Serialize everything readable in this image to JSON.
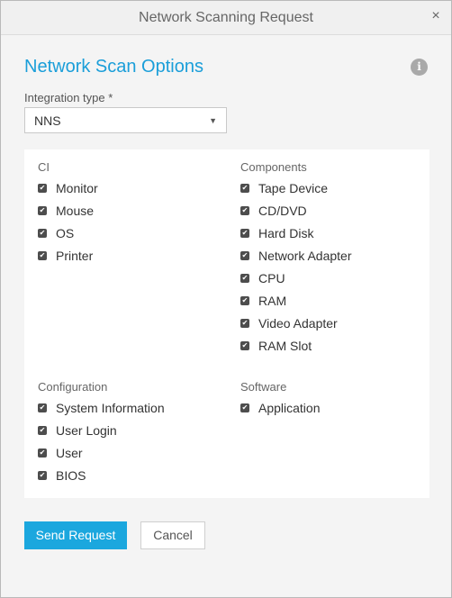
{
  "window": {
    "title": "Network Scanning Request",
    "close_glyph": "×"
  },
  "form": {
    "heading": "Network Scan Options",
    "info_icon": "i",
    "integration_label": "Integration type *",
    "integration_value": "NNS"
  },
  "groups": {
    "ci": {
      "title": "CI",
      "items": [
        "Monitor",
        "Mouse",
        "OS",
        "Printer"
      ]
    },
    "components": {
      "title": "Components",
      "items": [
        "Tape Device",
        "CD/DVD",
        "Hard Disk",
        "Network Adapter",
        "CPU",
        "RAM",
        "Video Adapter",
        "RAM Slot"
      ]
    },
    "configuration": {
      "title": "Configuration",
      "items": [
        "System Information",
        "User Login",
        "User",
        "BIOS"
      ]
    },
    "software": {
      "title": "Software",
      "items": [
        "Application"
      ]
    }
  },
  "buttons": {
    "send": "Send Request",
    "cancel": "Cancel"
  },
  "colors": {
    "accent": "#1a9ed9",
    "primary_button": "#1ba7de",
    "checkbox": "#4d4d4d"
  }
}
